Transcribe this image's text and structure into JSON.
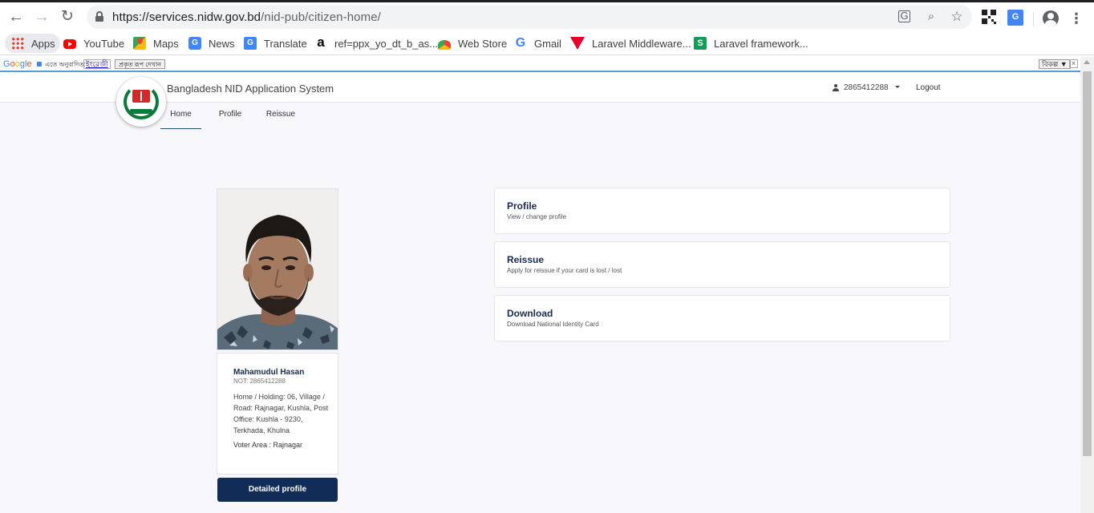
{
  "browser": {
    "url_host": "https://services.nidw.gov.bd",
    "url_path": "/nid-pub/citizen-home/",
    "bookmarks": [
      {
        "label": "Apps",
        "icon": "apps-grid-icon"
      },
      {
        "label": "YouTube",
        "icon": "youtube-icon"
      },
      {
        "label": "Maps",
        "icon": "maps-icon"
      },
      {
        "label": "News",
        "icon": "news-icon"
      },
      {
        "label": "Translate",
        "icon": "translate-icon"
      },
      {
        "label": "ref=ppx_yo_dt_b_as...",
        "icon": "amazon-icon"
      },
      {
        "label": "Web Store",
        "icon": "webstore-icon"
      },
      {
        "label": "Gmail",
        "icon": "google-icon"
      },
      {
        "label": "Laravel Middleware...",
        "icon": "laravel-icon"
      },
      {
        "label": "Laravel framework...",
        "icon": "laravel-s-icon"
      }
    ]
  },
  "translate_bar": {
    "logo": "Google",
    "prompt": "এতে অনুবাদিত:",
    "language": "ইংরেজী",
    "show_original": "প্রকৃত রূপ দেখান",
    "options": "বিকল্প ▼",
    "close": "×"
  },
  "site": {
    "title": "Bangladesh NID Application System",
    "user_id": "2865412288",
    "logout": "Logout",
    "tabs": [
      "Home",
      "Profile",
      "Reissue"
    ],
    "active_tab": "Home"
  },
  "profile": {
    "name": "Mahamudul Hasan",
    "nid": "NOT: 2865412288",
    "address": "Home / Holding: 06, Village / Road: Rajnagar, Kushla, Post Office: Kushla - 9230, Terkhada, Khulna",
    "voter_area": "Voter Area : Rajnagar",
    "detail_button": "Detailed profile"
  },
  "actions": [
    {
      "title": "Profile",
      "subtitle": "View / change profile"
    },
    {
      "title": "Reissue",
      "subtitle": "Apply for reissue if your card is lost / lost"
    },
    {
      "title": "Download",
      "subtitle": "Download National Identity Card"
    }
  ],
  "colors": {
    "accent": "#102c57",
    "page_bg": "#f8f7fb",
    "title_text": "#1a2b4f"
  }
}
